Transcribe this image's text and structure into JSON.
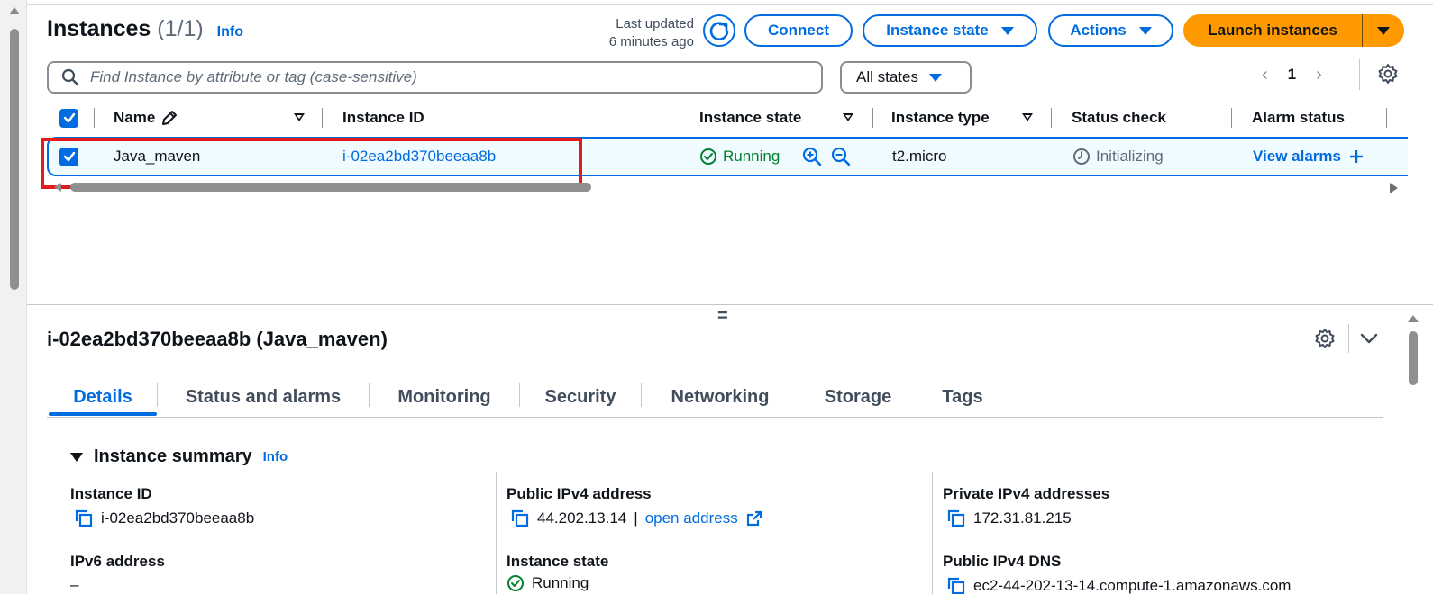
{
  "header": {
    "title": "Instances",
    "count": "(1/1)",
    "info": "Info",
    "last_updated_line1": "Last updated",
    "last_updated_line2": "6 minutes ago",
    "connect": "Connect",
    "instance_state": "Instance state",
    "actions": "Actions",
    "launch": "Launch instances"
  },
  "search": {
    "placeholder": "Find Instance by attribute or tag (case-sensitive)",
    "states_filter": "All states"
  },
  "pagination": {
    "page": "1"
  },
  "table": {
    "columns": [
      "Name",
      "Instance ID",
      "Instance state",
      "Instance type",
      "Status check",
      "Alarm status"
    ],
    "rows": [
      {
        "name": "Java_maven",
        "instance_id": "i-02ea2bd370beeaa8b",
        "state": "Running",
        "type": "t2.micro",
        "status_check": "Initializing",
        "alarm": "View alarms"
      }
    ]
  },
  "details": {
    "title": "i-02ea2bd370beeaa8b (Java_maven)",
    "tabs": [
      "Details",
      "Status and alarms",
      "Monitoring",
      "Security",
      "Networking",
      "Storage",
      "Tags"
    ],
    "active_tab": "Details",
    "summary_title": "Instance summary",
    "summary_info": "Info",
    "fields": {
      "instance_id_label": "Instance ID",
      "instance_id_value": "i-02ea2bd370beeaa8b",
      "ipv6_label": "IPv6 address",
      "ipv6_value": "–",
      "public_ipv4_label": "Public IPv4 address",
      "public_ipv4_value": "44.202.13.14",
      "separator": "|",
      "open_address": "open address",
      "instance_state_label": "Instance state",
      "instance_state_value": "Running",
      "private_ipv4_label": "Private IPv4 addresses",
      "private_ipv4_value": "172.31.81.215",
      "public_dns_label": "Public IPv4 DNS",
      "public_dns_value": "ec2-44-202-13-14.compute-1.amazonaws.com"
    }
  },
  "colors": {
    "accent": "#006ce0",
    "launch": "#ff9900",
    "running": "#00802f",
    "highlight_box": "#e21b1b"
  }
}
